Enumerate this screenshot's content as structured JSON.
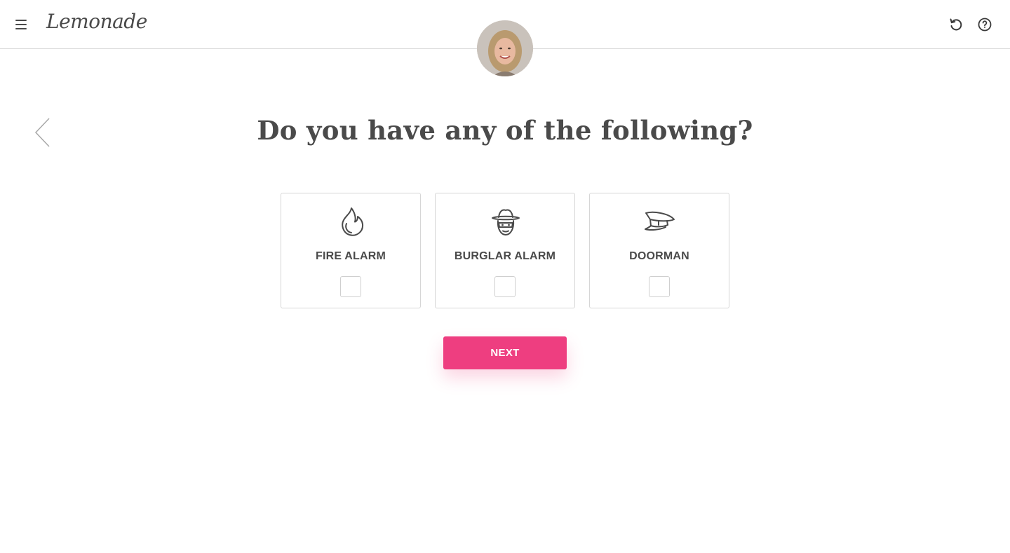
{
  "header": {
    "brand": "Lemonade",
    "menu_icon": "hamburger-menu-icon",
    "restart_icon": "restart-icon",
    "help_icon": "help-icon"
  },
  "assistant": {
    "avatar_icon": "assistant-avatar"
  },
  "question": {
    "text": "Do you have any of the following?"
  },
  "navigation": {
    "back_icon": "chevron-left-icon"
  },
  "options": [
    {
      "label": "FIRE ALARM",
      "icon": "flame-icon",
      "checked": false
    },
    {
      "label": "BURGLAR ALARM",
      "icon": "burglar-icon",
      "checked": false
    },
    {
      "label": "DOORMAN",
      "icon": "doorman-cap-icon",
      "checked": false
    }
  ],
  "actions": {
    "next_label": "NEXT"
  },
  "colors": {
    "accent": "#ee3e80",
    "text": "#4a4a4a",
    "border": "#d6d6d6"
  }
}
